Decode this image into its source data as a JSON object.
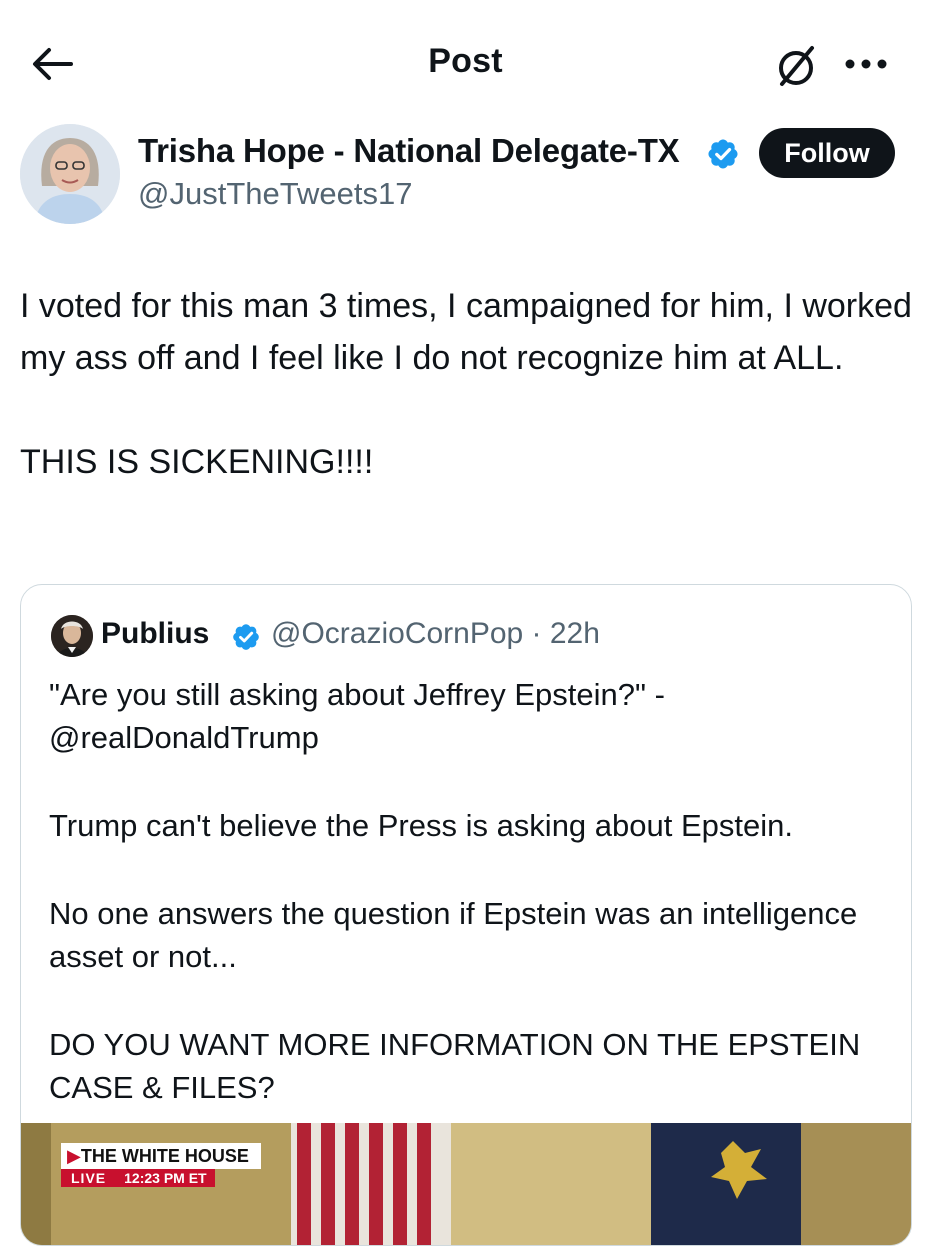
{
  "header": {
    "title": "Post"
  },
  "author": {
    "name": "Trisha Hope - National Delegate-TX",
    "handle": "@JustTheTweets17",
    "follow_label": "Follow"
  },
  "post": {
    "paragraphs": [
      "I voted for this man 3 times, I campaigned for him, I worked my ass off and I feel like I do not recognize him at ALL.",
      "THIS IS SICKENING!!!!"
    ]
  },
  "quote": {
    "name": "Publius",
    "handle_time": "@OcrazioCornPop · 22h",
    "paragraphs": [
      "\"Are you still asking about Jeffrey Epstein?\" - @realDonaldTrump",
      "Trump can't believe the Press is asking about Epstein.",
      "No one answers the question if Epstein was an intelligence asset or not...",
      "DO YOU WANT MORE INFORMATION ON THE EPSTEIN CASE & FILES?"
    ],
    "media": {
      "chyron_title": "THE WHITE HOUSE",
      "chyron_live": "LIVE",
      "chyron_time": "12:23 PM ET"
    }
  },
  "colors": {
    "verified": "#1d9bf0",
    "follow_bg": "#0f1419",
    "secondary_text": "#536471"
  },
  "icons": [
    "back-arrow-icon",
    "grok-icon",
    "more-icon",
    "verified-icon"
  ]
}
